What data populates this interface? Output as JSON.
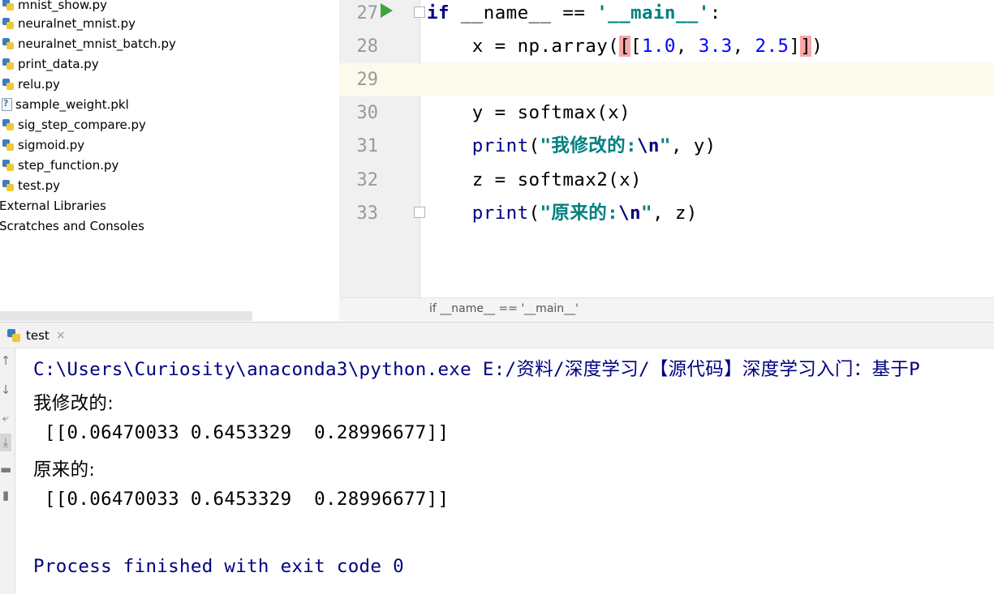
{
  "project_tree": {
    "items": [
      {
        "label": "mnist_show.py",
        "icon": "python-file-icon"
      },
      {
        "label": "neuralnet_mnist.py",
        "icon": "python-file-icon"
      },
      {
        "label": "neuralnet_mnist_batch.py",
        "icon": "python-file-icon"
      },
      {
        "label": "print_data.py",
        "icon": "python-file-icon"
      },
      {
        "label": "relu.py",
        "icon": "python-file-icon"
      },
      {
        "label": "sample_weight.pkl",
        "icon": "unknown-file-icon"
      },
      {
        "label": "sig_step_compare.py",
        "icon": "python-file-icon"
      },
      {
        "label": "sigmoid.py",
        "icon": "python-file-icon"
      },
      {
        "label": "step_function.py",
        "icon": "python-file-icon"
      },
      {
        "label": "test.py",
        "icon": "python-file-icon"
      },
      {
        "label": "External Libraries",
        "icon": ""
      },
      {
        "label": "Scratches and Consoles",
        "icon": ""
      }
    ]
  },
  "editor": {
    "line_numbers": [
      "27",
      "28",
      "29",
      "30",
      "31",
      "32",
      "33"
    ],
    "code": {
      "l27": {
        "kw": "if",
        "mid": " __name__ == ",
        "str": "'__main__'",
        "end": ":"
      },
      "l28": {
        "pre": "    x = np.array(",
        "b1": "[",
        "b2": "[",
        "n1": "1.0",
        "c1": ", ",
        "n2": "3.3",
        "c2": ", ",
        "n3": "2.5",
        "b3": "]",
        "b4": "]",
        "end": ")"
      },
      "l30": {
        "text": "    y = softmax(x)"
      },
      "l31": {
        "pre": "    ",
        "fn": "print",
        "p": "(",
        "str": "\"我修改的:",
        "esc": "\\n",
        "q": "\"",
        "rest": ", y)"
      },
      "l32": {
        "text": "    z = softmax2(x)"
      },
      "l33": {
        "pre": "    ",
        "fn": "print",
        "p": "(",
        "str": "\"原来的:",
        "esc": "\\n",
        "q": "\"",
        "rest": ", z)"
      }
    },
    "breadcrumb": "if __name__ == '__main__'"
  },
  "run_panel": {
    "tab_label": "test",
    "tab_close": "×",
    "toolbar_icons": [
      "arrow-up-icon",
      "arrow-down-icon",
      "soft-wrap-icon",
      "scroll-to-end-icon",
      "print-icon",
      "trash-icon"
    ],
    "console_lines": [
      "C:\\Users\\Curiosity\\anaconda3\\python.exe E:/资料/深度学习/【源代码】深度学习入门：基于P",
      "我修改的:",
      " [[0.06470033 0.6453329  0.28996677]]",
      "原来的:",
      " [[0.06470033 0.6453329  0.28996677]]",
      "",
      "Process finished with exit code 0"
    ]
  },
  "colors": {
    "keyword": "#000080",
    "string": "#008080",
    "number": "#0000ff",
    "brace_match": "#f7a8a8",
    "current_line": "#fcfaed",
    "console_system": "#000080",
    "run_icon": "#3ea53e"
  }
}
